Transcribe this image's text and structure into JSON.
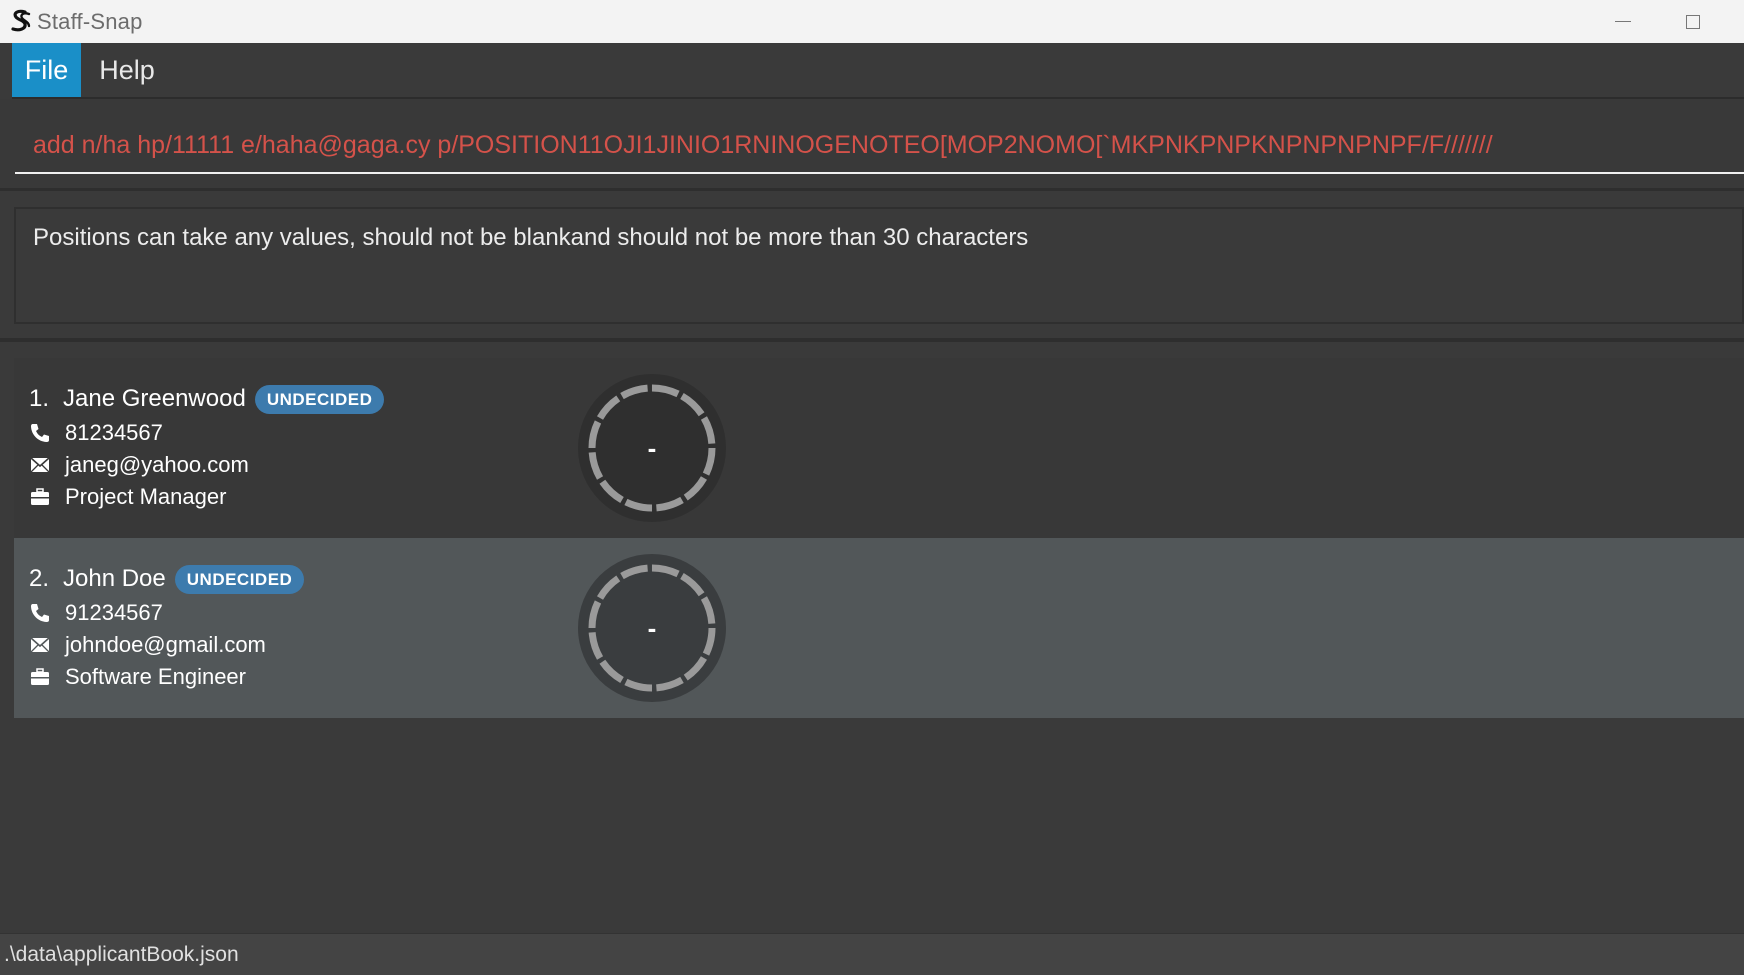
{
  "window": {
    "title": "Staff-Snap",
    "logo_icon": "staff-snap-logo-icon",
    "minimize_icon": "minimize-icon",
    "maximize_icon": "maximize-icon"
  },
  "menu": {
    "items": [
      {
        "label": "File",
        "active": true
      },
      {
        "label": "Help",
        "active": false
      }
    ]
  },
  "command": {
    "value": "add n/ha hp/11111 e/haha@gaga.cy p/POSITION11OJI1JINIO1RNINOGENOTEO[MOP2NOMO[`MKPNKPNPKNPNPNPNPF/F///////",
    "error_color": "#d4524a"
  },
  "result": {
    "message": "Positions can take any values, should not be blankand should not be more than 30 characters"
  },
  "applicants": [
    {
      "index": "1.",
      "name": "Jane Greenwood",
      "status": "UNDECIDED",
      "phone": "81234567",
      "email": "janeg@yahoo.com",
      "position": "Project Manager",
      "score": "-"
    },
    {
      "index": "2.",
      "name": "John Doe",
      "status": "UNDECIDED",
      "phone": "91234567",
      "email": "johndoe@gmail.com",
      "position": "Software Engineer",
      "score": "-"
    }
  ],
  "icons": {
    "phone": "phone-icon",
    "email": "envelope-icon",
    "position": "briefcase-icon"
  },
  "colors": {
    "accent": "#1a8fc8",
    "badge": "#3d7bad",
    "selected_row": "#525759"
  },
  "status_bar": {
    "path": ".\\data\\applicantBook.json"
  }
}
